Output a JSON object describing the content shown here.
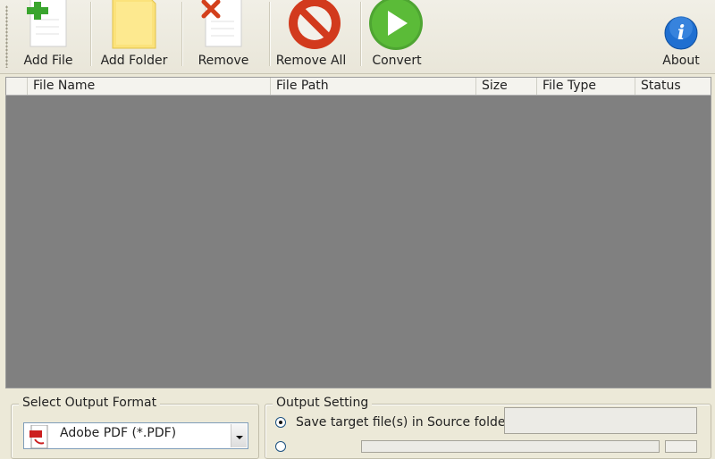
{
  "toolbar": {
    "add_file": "Add File",
    "add_folder": "Add Folder",
    "remove": "Remove",
    "remove_all": "Remove All",
    "convert": "Convert",
    "about": "About"
  },
  "file_list": {
    "columns": [
      "File Name",
      "File Path",
      "Size",
      "File Type",
      "Status"
    ],
    "rows": []
  },
  "output_format": {
    "group_label": "Select Output Format",
    "selected": "Adobe PDF (*.PDF)",
    "icon": "pdf-icon"
  },
  "output_setting": {
    "group_label": "Output Setting",
    "option_source_folder": "Save target file(s) in Source folder",
    "option_source_selected": true
  },
  "colors": {
    "background": "#ece9d8",
    "list_body": "#808080",
    "add_green": "#3aa52e",
    "remove_red": "#d3401c",
    "about_blue": "#1f6fd1"
  }
}
